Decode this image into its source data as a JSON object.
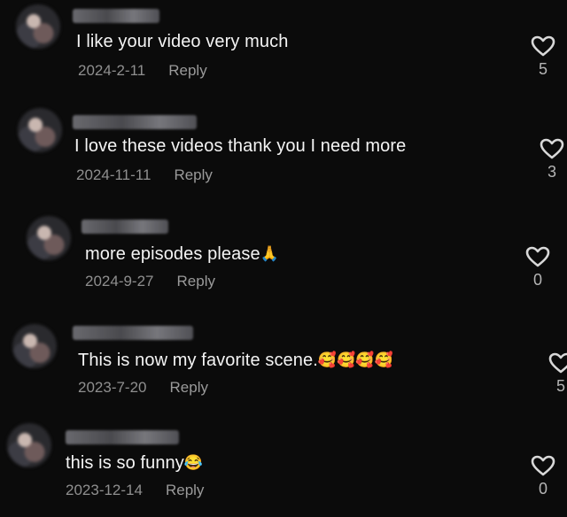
{
  "comments": [
    {
      "text": "I like your video very much",
      "emoji": "",
      "date": "2024-2-11",
      "reply": "Reply",
      "likes": "5"
    },
    {
      "text": "I love these videos thank you I need more",
      "emoji": "",
      "date": "2024-11-11",
      "reply": "Reply",
      "likes": "3"
    },
    {
      "text": "more episodes please",
      "emoji": "🙏",
      "date": "2024-9-27",
      "reply": "Reply",
      "likes": "0"
    },
    {
      "text": "This is now my favorite scene.",
      "emoji": "🥰🥰🥰🥰",
      "date": "2023-7-20",
      "reply": "Reply",
      "likes": "5"
    },
    {
      "text": "this is so funny",
      "emoji": "😂",
      "date": "2023-12-14",
      "reply": "Reply",
      "likes": "0"
    }
  ]
}
